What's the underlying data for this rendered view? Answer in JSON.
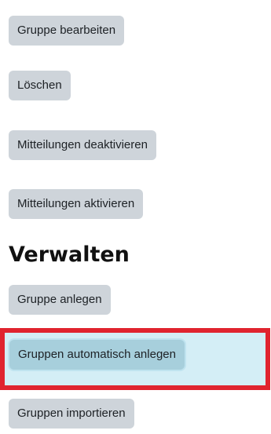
{
  "actions": {
    "edit_group": "Gruppe bearbeiten",
    "delete": "Löschen",
    "disable_messaging": "Mitteilungen deaktivieren",
    "enable_messaging": "Mitteilungen aktivieren"
  },
  "manage": {
    "heading": "Verwalten",
    "create_group": "Gruppe anlegen",
    "auto_create_groups": "Gruppen automatisch anlegen",
    "import_groups": "Gruppen importieren"
  },
  "colors": {
    "button_bg": "#ced4da",
    "highlighted_button_bg": "#a7cfdc",
    "highlight_border": "#e0242f",
    "text": "#1d2125"
  }
}
